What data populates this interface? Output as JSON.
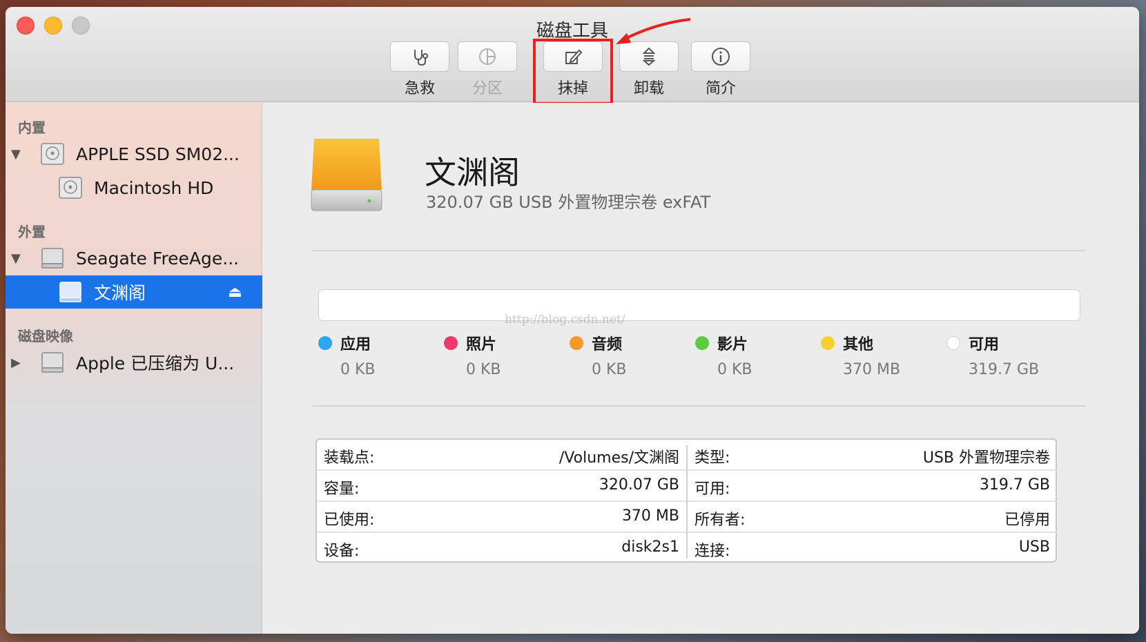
{
  "window": {
    "title": "磁盘工具"
  },
  "toolbar": {
    "items": [
      {
        "label": "急救",
        "icon": "stethoscope-icon",
        "enabled": true
      },
      {
        "label": "分区",
        "icon": "partition-pie-icon",
        "enabled": false
      },
      {
        "label": "抹掉",
        "icon": "erase-pencil-icon",
        "enabled": true
      },
      {
        "label": "卸载",
        "icon": "unmount-icon",
        "enabled": true
      },
      {
        "label": "简介",
        "icon": "info-icon",
        "enabled": true
      }
    ]
  },
  "sidebar": {
    "sections": [
      {
        "title": "内置"
      },
      {
        "title": "外置"
      },
      {
        "title": "磁盘映像"
      }
    ],
    "items": [
      {
        "label": "APPLE SSD SM02...",
        "icon": "internal-disk-icon",
        "expanded": true
      },
      {
        "label": "Macintosh HD",
        "icon": "internal-disk-icon"
      },
      {
        "label": "Seagate FreeAge...",
        "icon": "external-disk-icon",
        "expanded": true
      },
      {
        "label": "文渊阁",
        "icon": "external-volume-icon",
        "selected": true
      },
      {
        "label": "Apple 已压缩为 U...",
        "icon": "disk-image-icon",
        "expanded": false
      }
    ]
  },
  "volume": {
    "name": "文渊阁",
    "subtitle": "320.07 GB USB 外置物理宗卷 exFAT",
    "watermark": "http://blog.csdn.net/"
  },
  "usage": {
    "legend": [
      {
        "label": "应用",
        "value": "0 KB",
        "color": "#2ca6f0"
      },
      {
        "label": "照片",
        "value": "0 KB",
        "color": "#f0386b"
      },
      {
        "label": "音频",
        "value": "0 KB",
        "color": "#f49a27"
      },
      {
        "label": "影片",
        "value": "0 KB",
        "color": "#5ecb3f"
      },
      {
        "label": "其他",
        "value": "370 MB",
        "color": "#f8d02e"
      },
      {
        "label": "可用",
        "value": "319.7 GB",
        "color": "#ffffff"
      }
    ]
  },
  "info": {
    "left": [
      {
        "key": "装载点:",
        "value": "/Volumes/文渊阁"
      },
      {
        "key": "容量:",
        "value": "320.07 GB"
      },
      {
        "key": "已使用:",
        "value": "370 MB"
      },
      {
        "key": "设备:",
        "value": "disk2s1"
      }
    ],
    "right": [
      {
        "key": "类型:",
        "value": "USB 外置物理宗卷"
      },
      {
        "key": "可用:",
        "value": "319.7 GB"
      },
      {
        "key": "所有者:",
        "value": "已停用"
      },
      {
        "key": "连接:",
        "value": "USB"
      }
    ]
  }
}
